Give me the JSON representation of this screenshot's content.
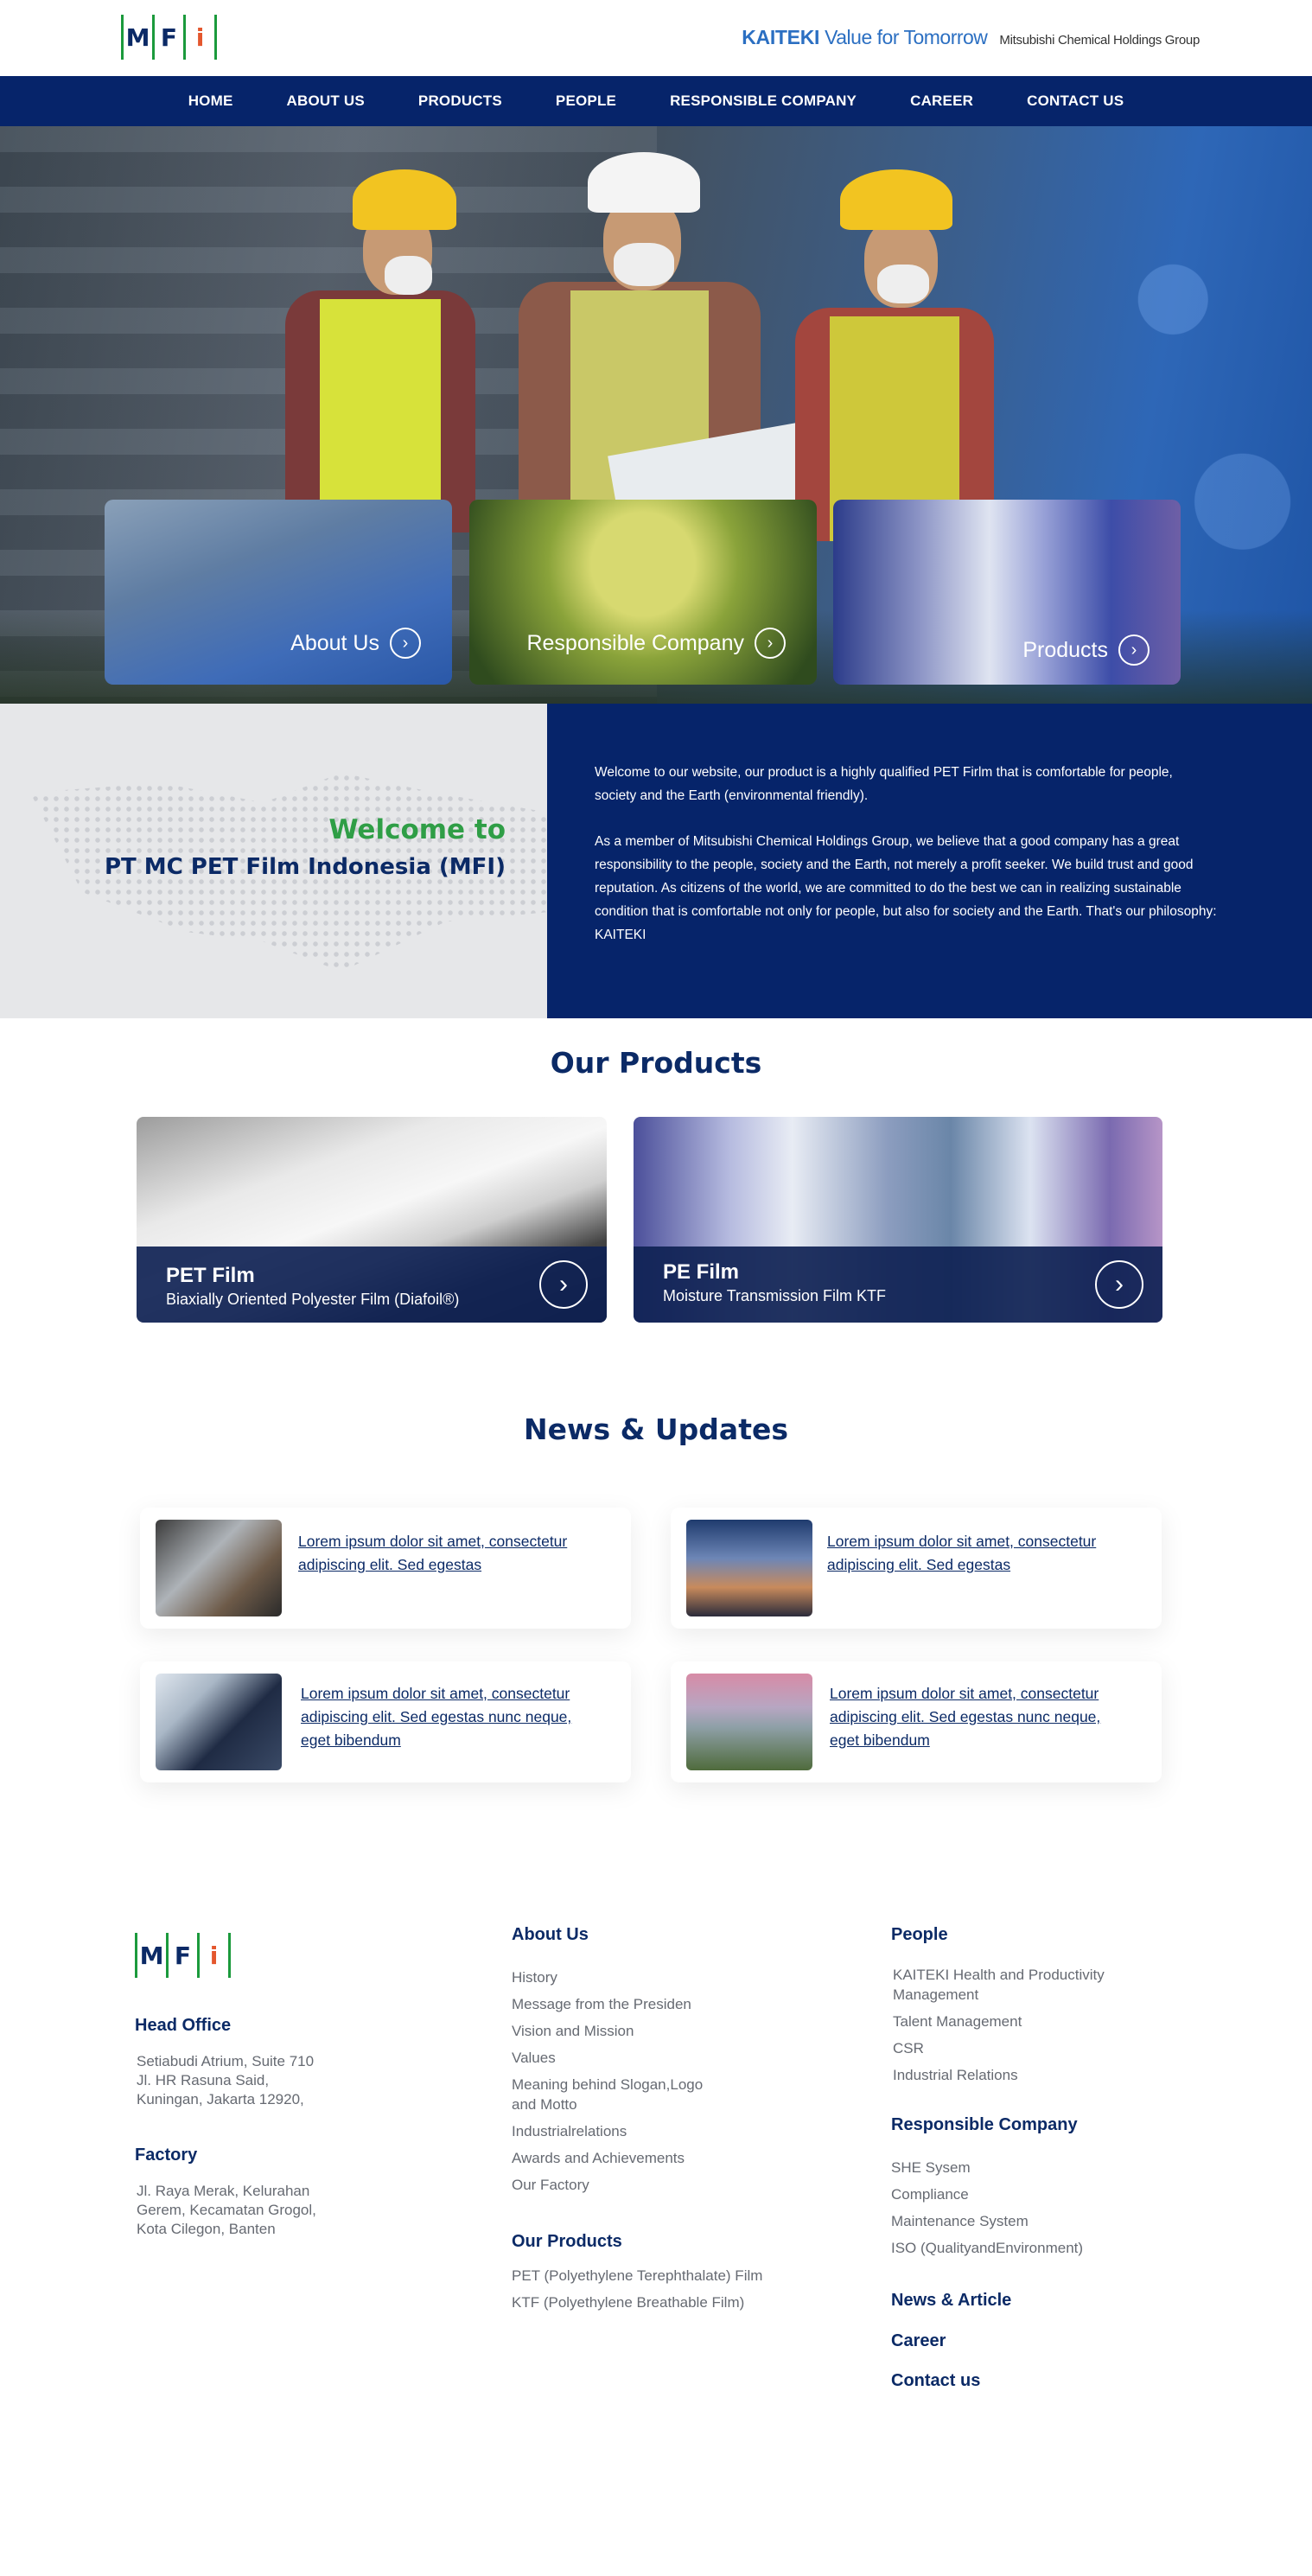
{
  "header": {
    "logo_letters": [
      "M",
      "F",
      "i"
    ],
    "brand_kaiteki": "KAITEKI",
    "brand_tagline": "Value for Tomorrow",
    "brand_group": "Mitsubishi Chemical Holdings Group"
  },
  "nav": [
    "HOME",
    "ABOUT US",
    "PRODUCTS",
    "PEOPLE",
    "RESPONSIBLE COMPANY",
    "CAREER",
    "CONTACT US"
  ],
  "hero_cards": [
    "About Us",
    "Responsible Company",
    "Products"
  ],
  "welcome": {
    "title_line1": "Welcome to",
    "title_line2": "PT MC PET Film Indonesia (MFI)",
    "para1": "Welcome to our website, our product is a highly qualified PET Firlm that is comfortable for people, society and the Earth (environmental friendly).",
    "para2": "As a member of Mitsubishi Chemical Holdings Group, we believe that a good company has a great responsibility to the people, society and the Earth, not merely a profit seeker. We build trust and good reputation. As citizens of the world, we are committed to do the best we can in realizing sustainable condition that is comfortable not only for people, but also for society and the Earth. That's our philosophy: KAITEKI"
  },
  "products": {
    "title": "Our Products",
    "items": [
      {
        "name": "PET Film",
        "desc": "Biaxially Oriented Polyester Film (Diafoil®)"
      },
      {
        "name": "PE Film",
        "desc": "Moisture Transmission Film KTF"
      }
    ]
  },
  "news": {
    "title": "News & Updates",
    "items": [
      "Lorem ipsum dolor sit amet, consectetur adipiscing elit. Sed egestas",
      "Lorem ipsum dolor sit amet, consectetur adipiscing elit. Sed egestas",
      "Lorem ipsum dolor sit amet, consectetur adipiscing elit. Sed egestas nunc neque, eget bibendum",
      "Lorem ipsum dolor sit amet, consectetur adipiscing elit. Sed egestas nunc neque, eget bibendum"
    ]
  },
  "footer": {
    "head_office_title": "Head Office",
    "head_office_address": [
      "Setiabudi Atrium, Suite 710",
      "Jl. HR Rasuna Said,",
      "Kuningan, Jakarta 12920,"
    ],
    "factory_title": "Factory",
    "factory_address": [
      "Jl. Raya Merak, Kelurahan",
      "Gerem, Kecamatan Grogol,",
      "Kota Cilegon, Banten"
    ],
    "about_title": "About Us",
    "about_links": [
      "History",
      "Message from the Presiden",
      "Vision and Mission",
      "Values",
      "Meaning behind Slogan,Logo and Motto",
      "Industrialrelations",
      "Awards and Achievements",
      "Our Factory"
    ],
    "products_title": "Our Products",
    "products_links": [
      "PET (Polyethylene Terephthalate) Film",
      "KTF (Polyethylene Breathable Film)"
    ],
    "people_title": "People",
    "people_links": [
      "KAITEKI Health and Productivity Management",
      "Talent Management",
      "CSR",
      "Industrial Relations"
    ],
    "responsible_title": "Responsible Company",
    "responsible_links": [
      "SHE Sysem",
      "Compliance",
      "Maintenance System",
      "ISO (QualityandEnvironment)"
    ],
    "news_link": "News & Article",
    "career_link": "Career",
    "contact_link": "Contact us"
  },
  "colors": {
    "navy": "#06246a",
    "green": "#2f9e46",
    "kaiteki_blue": "#2b6fc2"
  }
}
